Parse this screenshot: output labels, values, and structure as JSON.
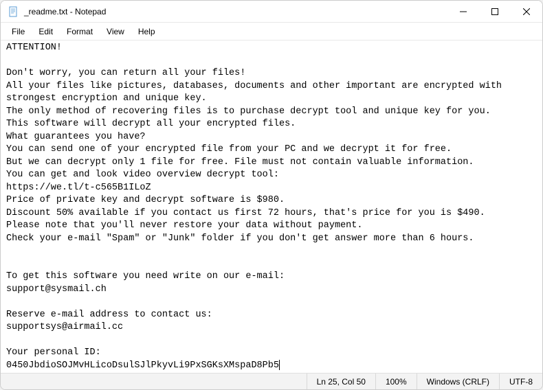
{
  "titlebar": {
    "icon": "notepad-icon",
    "title": "_readme.txt - Notepad"
  },
  "menubar": {
    "items": [
      "File",
      "Edit",
      "Format",
      "View",
      "Help"
    ]
  },
  "content": {
    "text": "ATTENTION!\n\nDon't worry, you can return all your files!\nAll your files like pictures, databases, documents and other important are encrypted with strongest encryption and unique key.\nThe only method of recovering files is to purchase decrypt tool and unique key for you.\nThis software will decrypt all your encrypted files.\nWhat guarantees you have?\nYou can send one of your encrypted file from your PC and we decrypt it for free.\nBut we can decrypt only 1 file for free. File must not contain valuable information.\nYou can get and look video overview decrypt tool:\nhttps://we.tl/t-c565B1ILoZ\nPrice of private key and decrypt software is $980.\nDiscount 50% available if you contact us first 72 hours, that's price for you is $490.\nPlease note that you'll never restore your data without payment.\nCheck your e-mail \"Spam\" or \"Junk\" folder if you don't get answer more than 6 hours.\n\n\nTo get this software you need write on our e-mail:\nsupport@sysmail.ch\n\nReserve e-mail address to contact us:\nsupportsys@airmail.cc\n\nYour personal ID:\n0450JbdioSOJMvHLicoDsulSJlPkyvLi9PxSGKsXMspaD8Pb5"
  },
  "statusbar": {
    "position": "Ln 25, Col 50",
    "zoom": "100%",
    "lineending": "Windows (CRLF)",
    "encoding": "UTF-8"
  }
}
